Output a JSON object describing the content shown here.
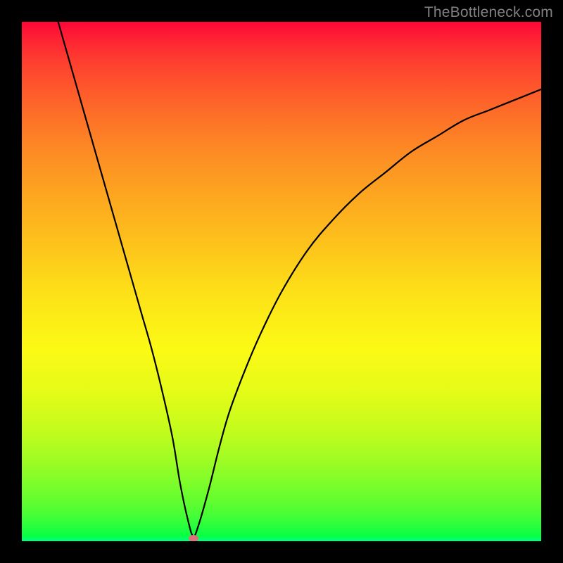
{
  "watermark": "TheBottleneck.com",
  "colors": {
    "frame": "#000000",
    "gradient_top": "#fe0537",
    "gradient_bottom": "#00ff84",
    "curve": "#000000",
    "marker": "#d9747c",
    "watermark": "#808080"
  },
  "chart_data": {
    "type": "line",
    "title": "",
    "xlabel": "",
    "ylabel": "",
    "xlim": [
      0,
      100
    ],
    "ylim": [
      0,
      100
    ],
    "grid": false,
    "series": [
      {
        "name": "bottleneck-curve",
        "x": [
          7,
          9,
          11,
          13,
          15,
          17,
          19,
          21,
          23,
          25,
          27,
          29,
          30.5,
          32,
          33,
          34,
          36,
          38,
          40,
          43,
          46,
          50,
          55,
          60,
          65,
          70,
          75,
          80,
          85,
          90,
          95,
          100
        ],
        "y": [
          100,
          93,
          86,
          79,
          72,
          65,
          58,
          51,
          44,
          37,
          29,
          20,
          11,
          4,
          1,
          3,
          10,
          18,
          25,
          33,
          40,
          48,
          56,
          62,
          67,
          71,
          75,
          78,
          81,
          83,
          85,
          87
        ]
      }
    ],
    "annotations": [
      {
        "name": "min-marker",
        "x": 33,
        "y": 0.5
      }
    ]
  }
}
